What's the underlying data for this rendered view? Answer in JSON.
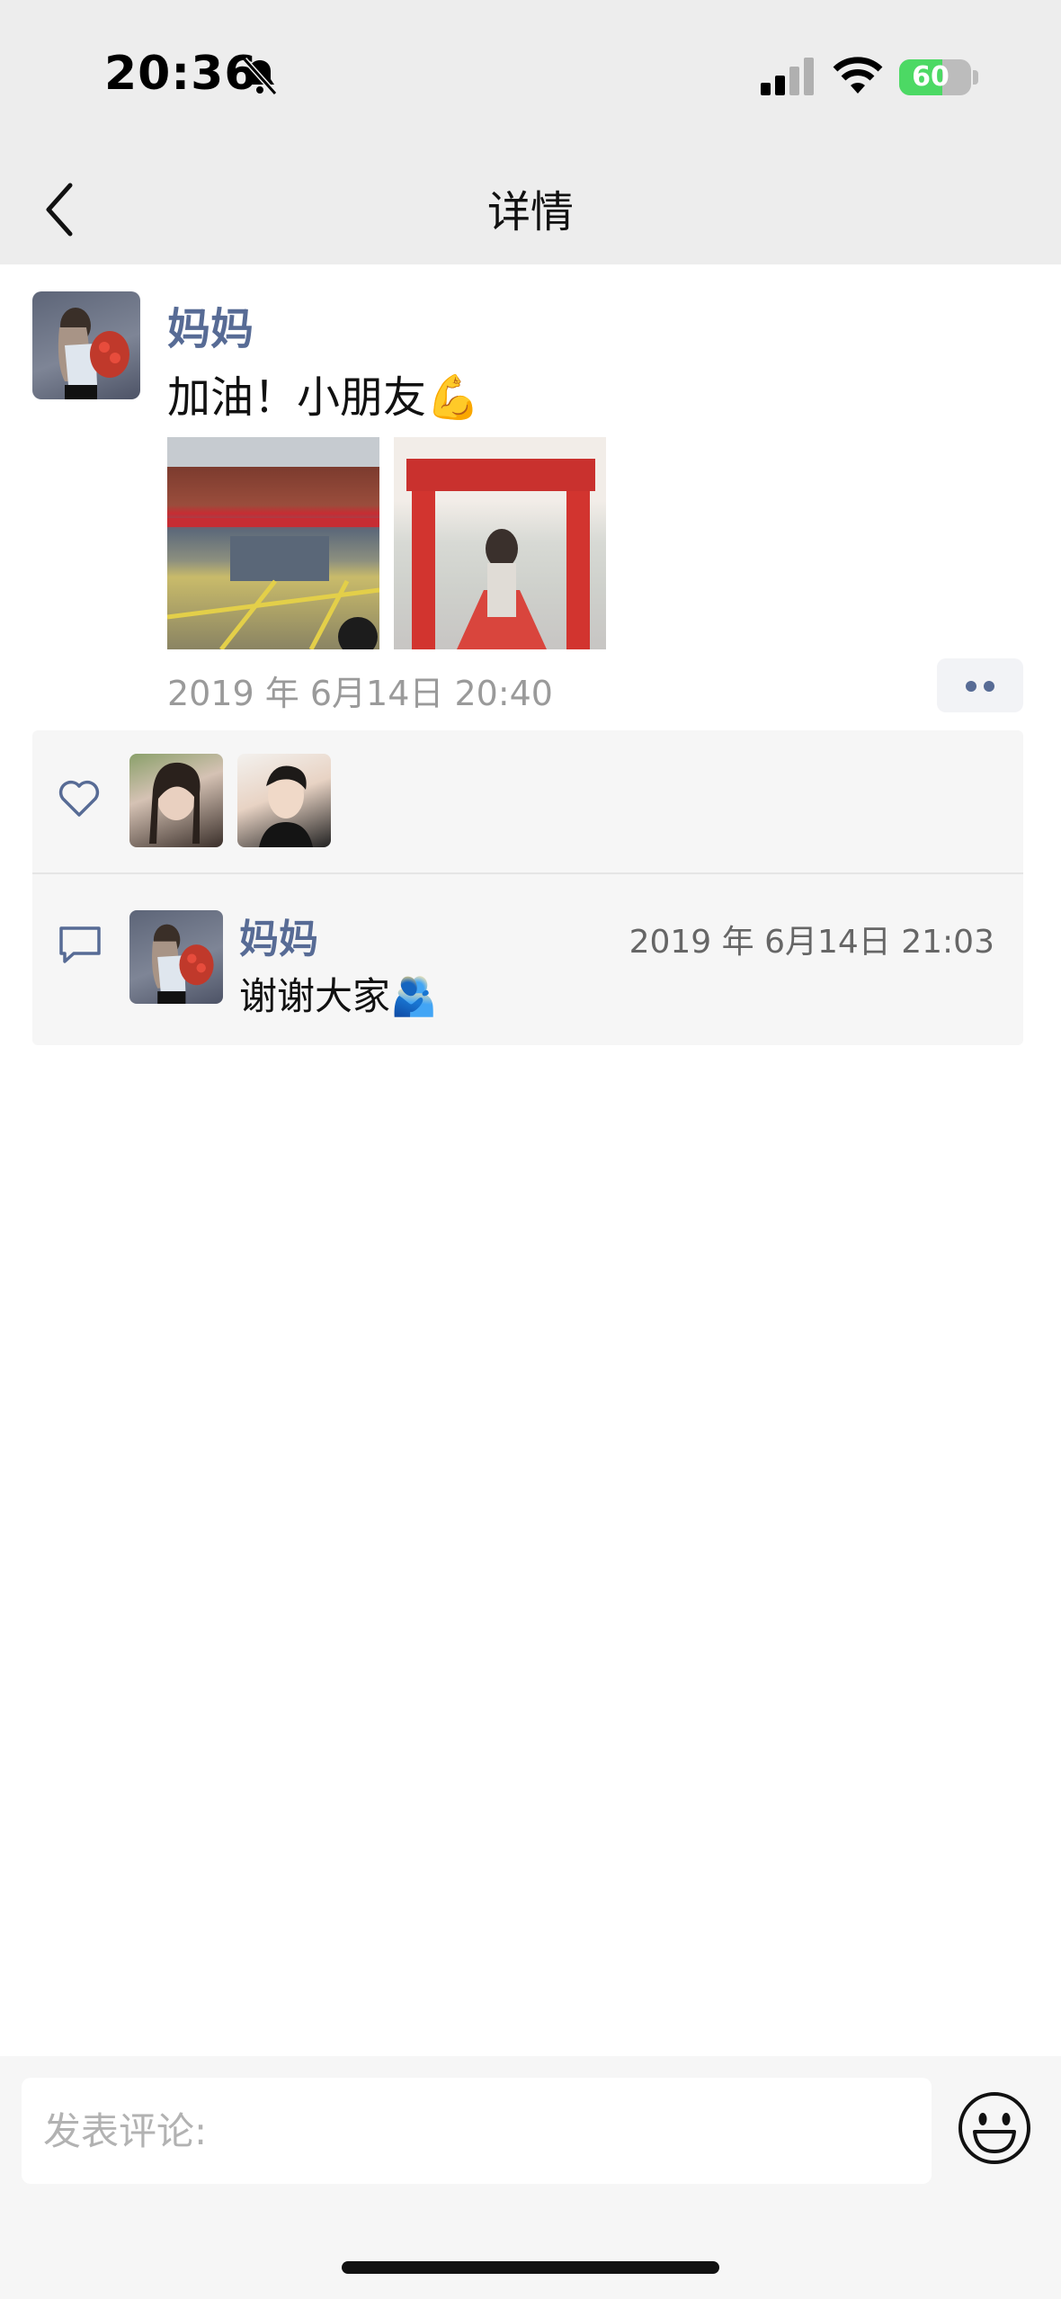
{
  "status_bar": {
    "time": "20:36",
    "battery_level": "60",
    "battery_fraction": 0.6,
    "icons": [
      "bell-muted-icon",
      "signal-icon",
      "wifi-icon",
      "battery-charging-icon"
    ]
  },
  "nav": {
    "back_icon": "chevron-left-icon",
    "title": "详情"
  },
  "post": {
    "author": "妈妈",
    "text": "加油！小朋友💪",
    "photos": [
      "school-gate-photo",
      "red-arch-photo"
    ],
    "timestamp": "2019 年 6月14日 20:40",
    "more_icon": "two-dots-icon"
  },
  "likes": {
    "icon": "heart-outline-icon",
    "avatars": [
      "liker-avatar-1",
      "liker-avatar-2"
    ]
  },
  "comments": [
    {
      "author": "妈妈",
      "time": "2019 年 6月14日 21:03",
      "text": "谢谢大家🫂"
    }
  ],
  "comment_icon": "comment-bubble-icon",
  "composer": {
    "placeholder": "发表评论:",
    "emoji_icon": "smiley-icon"
  },
  "colors": {
    "link_blue": "#576b95",
    "bar_gray": "#ededed",
    "panel_gray": "#f6f6f6",
    "battery_green": "#4cd964"
  }
}
